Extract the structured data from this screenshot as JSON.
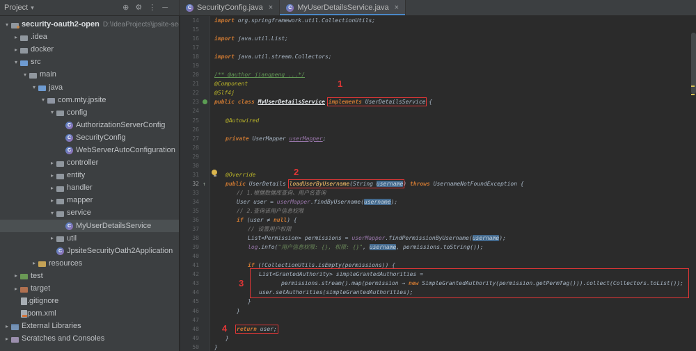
{
  "colors": {
    "panel_bg": "#3c3f41",
    "editor_bg": "#2b2b2b",
    "selection_bg": "#4b5052",
    "tab_underline": "#4a88c7",
    "annotation_red": "#e23636",
    "keyword_orange": "#cc7832",
    "annotation_yellow": "#bbb529",
    "string_green": "#6a8759",
    "field_purple": "#9876aa",
    "occurrence_highlight": "#43698d"
  },
  "toolbar": {
    "project_label": "Project",
    "icons": [
      {
        "name": "locate-icon",
        "glyph": "⊕"
      },
      {
        "name": "settings-icon",
        "glyph": "⚙"
      },
      {
        "name": "more-icon",
        "glyph": "⋮"
      },
      {
        "name": "hide-icon",
        "glyph": "─"
      }
    ]
  },
  "tabs": [
    {
      "label": "SecurityConfig.java",
      "active": false
    },
    {
      "label": "MyUserDetailsService.java",
      "active": true
    }
  ],
  "tree": [
    {
      "label": "security-oauth2-open",
      "hint": "D:\\IdeaProjects\\jpsite-security-oauth",
      "level": 0,
      "icon": "project",
      "arrow": "down",
      "root": true
    },
    {
      "label": ".idea",
      "level": 1,
      "icon": "folder",
      "arrow": "right"
    },
    {
      "label": "docker",
      "level": 1,
      "icon": "folder",
      "arrow": "right"
    },
    {
      "label": "src",
      "level": 1,
      "icon": "src",
      "arrow": "down"
    },
    {
      "label": "main",
      "level": 2,
      "icon": "folder",
      "arrow": "down"
    },
    {
      "label": "java",
      "level": 3,
      "icon": "src",
      "arrow": "down"
    },
    {
      "label": "com.mty.jpsite",
      "level": 4,
      "icon": "pkg",
      "arrow": "down"
    },
    {
      "label": "config",
      "level": 5,
      "icon": "folder",
      "arrow": "down"
    },
    {
      "label": "AuthorizationServerConfig",
      "level": 6,
      "icon": "class"
    },
    {
      "label": "SecurityConfig",
      "level": 6,
      "icon": "class"
    },
    {
      "label": "WebServerAutoConfiguration",
      "level": 6,
      "icon": "class"
    },
    {
      "label": "controller",
      "level": 5,
      "icon": "folder",
      "arrow": "right"
    },
    {
      "label": "entity",
      "level": 5,
      "icon": "folder",
      "arrow": "right"
    },
    {
      "label": "handler",
      "level": 5,
      "icon": "folder",
      "arrow": "right"
    },
    {
      "label": "mapper",
      "level": 5,
      "icon": "folder",
      "arrow": "right"
    },
    {
      "label": "service",
      "level": 5,
      "icon": "folder",
      "arrow": "down"
    },
    {
      "label": "MyUserDetailsService",
      "level": 6,
      "icon": "class",
      "selected": true
    },
    {
      "label": "util",
      "level": 5,
      "icon": "folder",
      "arrow": "right"
    },
    {
      "label": "JpsiteSecurityOath2Application",
      "level": 5,
      "icon": "class"
    },
    {
      "label": "resources",
      "level": 3,
      "icon": "res",
      "arrow": "right"
    },
    {
      "label": "test",
      "level": 1,
      "icon": "test",
      "arrow": "right"
    },
    {
      "label": "target",
      "level": 1,
      "icon": "excl",
      "arrow": "right"
    },
    {
      "label": ".gitignore",
      "level": 1,
      "icon": "file"
    },
    {
      "label": "pom.xml",
      "level": 1,
      "icon": "pom"
    },
    {
      "label": "External Libraries",
      "level": 0,
      "icon": "libs",
      "arrow": "right"
    },
    {
      "label": "Scratches and Consoles",
      "level": 0,
      "icon": "scratch",
      "arrow": "right"
    }
  ],
  "editor": {
    "current_line": 32,
    "lines": [
      {
        "no": 14,
        "ind": 0,
        "segs": [
          [
            "k",
            "import "
          ],
          [
            "d",
            "org.springframework.util.CollectionUtils;"
          ]
        ]
      },
      {
        "no": 15,
        "ind": 0,
        "segs": []
      },
      {
        "no": 16,
        "ind": 0,
        "segs": [
          [
            "k",
            "import "
          ],
          [
            "d",
            "java.util.List;"
          ]
        ]
      },
      {
        "no": 17,
        "ind": 0,
        "segs": []
      },
      {
        "no": 18,
        "ind": 0,
        "segs": [
          [
            "k",
            "import "
          ],
          [
            "d",
            "java.util.stream.Collectors;"
          ]
        ]
      },
      {
        "no": 19,
        "ind": 0,
        "segs": []
      },
      {
        "no": 20,
        "ind": 0,
        "segs": [
          [
            "dc",
            "/** @author jiangpeng ...*/"
          ]
        ]
      },
      {
        "no": 21,
        "ind": 0,
        "segs": [
          [
            "a",
            "@Component"
          ]
        ]
      },
      {
        "no": 22,
        "ind": 0,
        "segs": [
          [
            "a",
            "@Slf4j"
          ]
        ]
      },
      {
        "no": 23,
        "ind": 0,
        "marker": "impl",
        "box": [
          3,
          4
        ],
        "segs": [
          [
            "k",
            "public class "
          ],
          [
            "cls",
            "MyUserDetailsService"
          ],
          [
            "d",
            " "
          ],
          [
            "k",
            "implements "
          ],
          [
            "d",
            "UserDetailsService"
          ],
          [
            "d",
            " {"
          ]
        ]
      },
      {
        "no": 24,
        "ind": 0,
        "segs": []
      },
      {
        "no": 25,
        "ind": 1,
        "segs": [
          [
            "a",
            "@Autowired"
          ]
        ]
      },
      {
        "no": 26,
        "ind": 0,
        "segs": []
      },
      {
        "no": 27,
        "ind": 1,
        "segs": [
          [
            "k",
            "private "
          ],
          [
            "d",
            "UserMapper "
          ],
          [
            "fu",
            "userMapper"
          ],
          [
            "d",
            ";"
          ]
        ]
      },
      {
        "no": 28,
        "ind": 0,
        "segs": []
      },
      {
        "no": 29,
        "ind": 0,
        "segs": []
      },
      {
        "no": 30,
        "ind": 0,
        "segs": []
      },
      {
        "no": 31,
        "ind": 1,
        "segs": [
          [
            "a",
            "@Override"
          ]
        ]
      },
      {
        "no": 32,
        "ind": 1,
        "marker": "ovr",
        "box": [
          2,
          5
        ],
        "segs": [
          [
            "k",
            "public "
          ],
          [
            "d",
            "UserDetails "
          ],
          [
            "m",
            "loadUserByUsername"
          ],
          [
            "d",
            "("
          ],
          [
            "d",
            "String "
          ],
          [
            "hl",
            "username"
          ],
          [
            "d",
            ") "
          ],
          [
            "k",
            "throws "
          ],
          [
            "d",
            "UsernameNotFoundException {"
          ]
        ]
      },
      {
        "no": 33,
        "ind": 2,
        "segs": [
          [
            "c",
            "// 1.根据数据库查询、用户名查询"
          ]
        ]
      },
      {
        "no": 34,
        "ind": 2,
        "segs": [
          [
            "d",
            "User user = "
          ],
          [
            "f",
            "userMapper"
          ],
          [
            "d",
            ".findByUsername("
          ],
          [
            "hl",
            "username"
          ],
          [
            "d",
            ");"
          ]
        ]
      },
      {
        "no": 35,
        "ind": 2,
        "segs": [
          [
            "c",
            "// 2.查询该用户信息权限"
          ]
        ]
      },
      {
        "no": 36,
        "ind": 2,
        "segs": [
          [
            "k",
            "if "
          ],
          [
            "d",
            "(user ≠ "
          ],
          [
            "k",
            "null"
          ],
          [
            "d",
            ") {"
          ]
        ]
      },
      {
        "no": 37,
        "ind": 3,
        "segs": [
          [
            "c",
            "// 设置用户权限"
          ]
        ]
      },
      {
        "no": 38,
        "ind": 3,
        "segs": [
          [
            "d",
            "List<Permission> permissions = "
          ],
          [
            "f",
            "userMapper"
          ],
          [
            "d",
            ".findPermissionByUsername("
          ],
          [
            "hl",
            "username"
          ],
          [
            "d",
            ");"
          ]
        ]
      },
      {
        "no": 39,
        "ind": 3,
        "segs": [
          [
            "f",
            "log"
          ],
          [
            "d",
            ".info("
          ],
          [
            "s",
            "\"用户信息权限: {}, 权限: {}\""
          ],
          [
            "d",
            ", "
          ],
          [
            "hl",
            "username"
          ],
          [
            "d",
            ", permissions.toString());"
          ]
        ]
      },
      {
        "no": 40,
        "ind": 0,
        "segs": []
      },
      {
        "no": 41,
        "ind": 3,
        "segs": [
          [
            "k",
            "if "
          ],
          [
            "d",
            "(!CollectionUtils.isEmpty(permissions)) {"
          ]
        ]
      },
      {
        "no": 42,
        "ind": 4,
        "segs": [
          [
            "d",
            "List<GrantedAuthority> simpleGrantedAuthorities ="
          ]
        ]
      },
      {
        "no": 43,
        "ind": 6,
        "segs": [
          [
            "d",
            "permissions.stream().map(permission → "
          ],
          [
            "k",
            "new "
          ],
          [
            "d",
            "SimpleGrantedAuthority(permission.getPermTag())).collect(Collectors.toList());"
          ]
        ]
      },
      {
        "no": 44,
        "ind": 4,
        "segs": [
          [
            "d",
            "user.setAuthorities(simpleGrantedAuthorities);"
          ]
        ]
      },
      {
        "no": 45,
        "ind": 3,
        "segs": [
          [
            "d",
            "}"
          ]
        ]
      },
      {
        "no": 46,
        "ind": 2,
        "segs": [
          [
            "d",
            "}"
          ]
        ]
      },
      {
        "no": 47,
        "ind": 0,
        "segs": []
      },
      {
        "no": 48,
        "ind": 2,
        "box": [
          0,
          1
        ],
        "segs": [
          [
            "k",
            "return "
          ],
          [
            "d",
            "user;"
          ]
        ]
      },
      {
        "no": 49,
        "ind": 1,
        "segs": [
          [
            "d",
            "}"
          ]
        ]
      },
      {
        "no": 50,
        "ind": 0,
        "segs": [
          [
            "d",
            "}"
          ]
        ]
      }
    ]
  },
  "annotations": [
    "1",
    "2",
    "3",
    "4"
  ]
}
